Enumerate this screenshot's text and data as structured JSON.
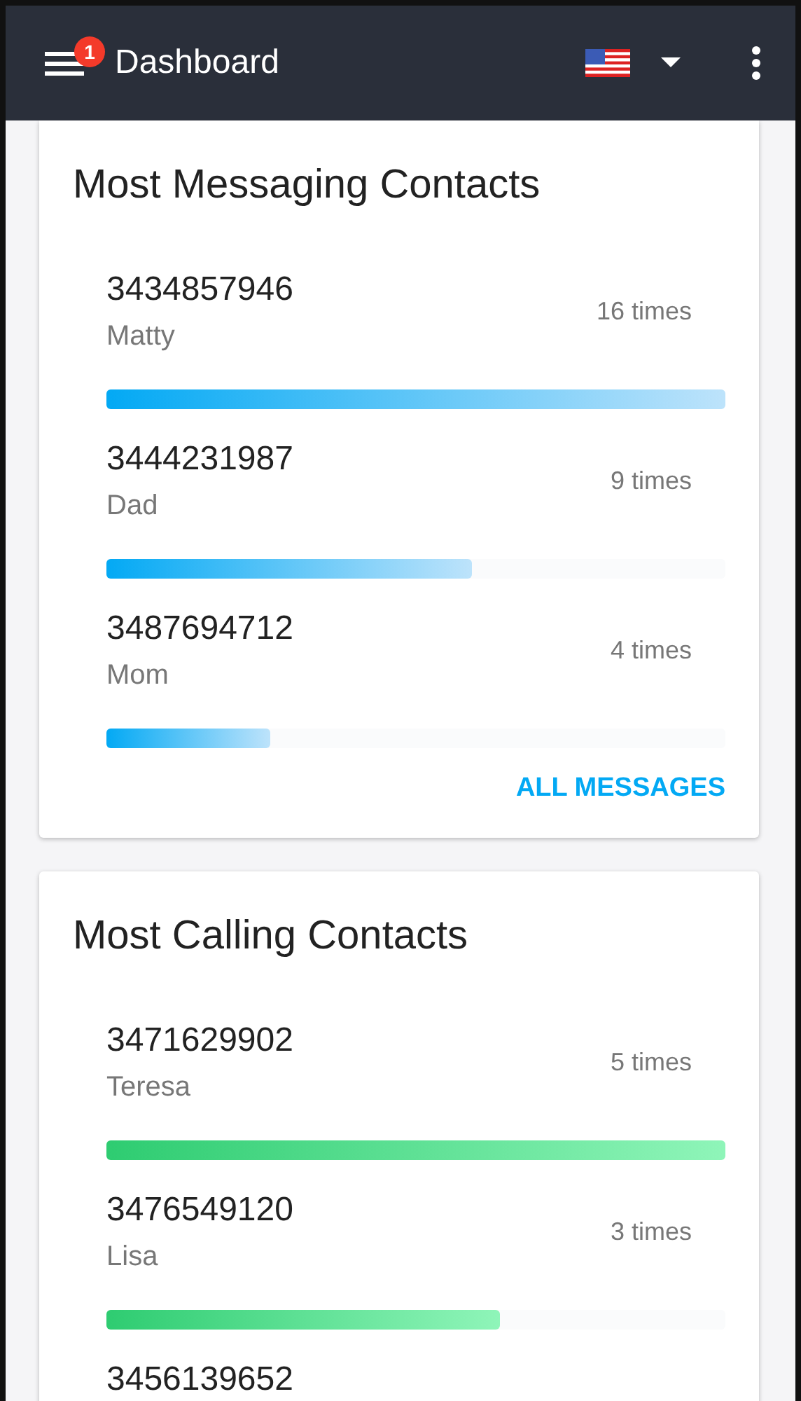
{
  "header": {
    "title": "Dashboard",
    "badge": "1"
  },
  "cards": [
    {
      "title": "Most Messaging Contacts",
      "kind": "messages",
      "contacts": [
        {
          "number": "3434857946",
          "name": "Matty",
          "count": "16 times",
          "level": 1
        },
        {
          "number": "3444231987",
          "name": "Dad",
          "count": "9 times",
          "level": 0.59
        },
        {
          "number": "3487694712",
          "name": "Mom",
          "count": "4 times",
          "level": 0.265
        }
      ],
      "action": "ALL MESSAGES"
    },
    {
      "title": "Most Calling Contacts",
      "kind": "calls",
      "contacts": [
        {
          "number": "3471629902",
          "name": "Teresa",
          "count": "5 times",
          "level": 1
        },
        {
          "number": "3476549120",
          "name": "Lisa",
          "count": "3 times",
          "level": 0.635
        },
        {
          "number": "3456139652"
        }
      ]
    }
  ]
}
